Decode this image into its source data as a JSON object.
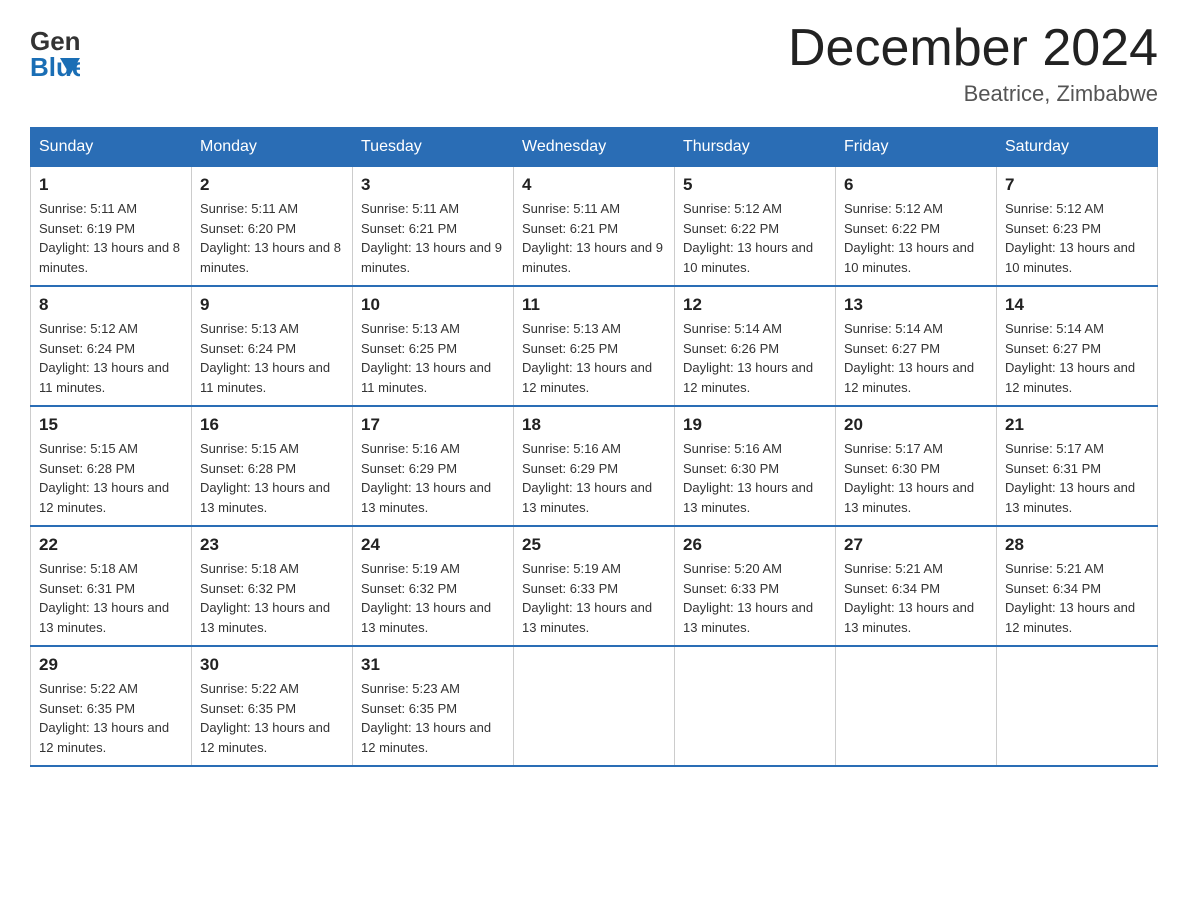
{
  "header": {
    "logo_general": "General",
    "logo_blue": "Blue",
    "month_title": "December 2024",
    "location": "Beatrice, Zimbabwe"
  },
  "weekdays": [
    "Sunday",
    "Monday",
    "Tuesday",
    "Wednesday",
    "Thursday",
    "Friday",
    "Saturday"
  ],
  "weeks": [
    [
      {
        "day": "1",
        "sunrise": "5:11 AM",
        "sunset": "6:19 PM",
        "daylight": "13 hours and 8 minutes."
      },
      {
        "day": "2",
        "sunrise": "5:11 AM",
        "sunset": "6:20 PM",
        "daylight": "13 hours and 8 minutes."
      },
      {
        "day": "3",
        "sunrise": "5:11 AM",
        "sunset": "6:21 PM",
        "daylight": "13 hours and 9 minutes."
      },
      {
        "day": "4",
        "sunrise": "5:11 AM",
        "sunset": "6:21 PM",
        "daylight": "13 hours and 9 minutes."
      },
      {
        "day": "5",
        "sunrise": "5:12 AM",
        "sunset": "6:22 PM",
        "daylight": "13 hours and 10 minutes."
      },
      {
        "day": "6",
        "sunrise": "5:12 AM",
        "sunset": "6:22 PM",
        "daylight": "13 hours and 10 minutes."
      },
      {
        "day": "7",
        "sunrise": "5:12 AM",
        "sunset": "6:23 PM",
        "daylight": "13 hours and 10 minutes."
      }
    ],
    [
      {
        "day": "8",
        "sunrise": "5:12 AM",
        "sunset": "6:24 PM",
        "daylight": "13 hours and 11 minutes."
      },
      {
        "day": "9",
        "sunrise": "5:13 AM",
        "sunset": "6:24 PM",
        "daylight": "13 hours and 11 minutes."
      },
      {
        "day": "10",
        "sunrise": "5:13 AM",
        "sunset": "6:25 PM",
        "daylight": "13 hours and 11 minutes."
      },
      {
        "day": "11",
        "sunrise": "5:13 AM",
        "sunset": "6:25 PM",
        "daylight": "13 hours and 12 minutes."
      },
      {
        "day": "12",
        "sunrise": "5:14 AM",
        "sunset": "6:26 PM",
        "daylight": "13 hours and 12 minutes."
      },
      {
        "day": "13",
        "sunrise": "5:14 AM",
        "sunset": "6:27 PM",
        "daylight": "13 hours and 12 minutes."
      },
      {
        "day": "14",
        "sunrise": "5:14 AM",
        "sunset": "6:27 PM",
        "daylight": "13 hours and 12 minutes."
      }
    ],
    [
      {
        "day": "15",
        "sunrise": "5:15 AM",
        "sunset": "6:28 PM",
        "daylight": "13 hours and 12 minutes."
      },
      {
        "day": "16",
        "sunrise": "5:15 AM",
        "sunset": "6:28 PM",
        "daylight": "13 hours and 13 minutes."
      },
      {
        "day": "17",
        "sunrise": "5:16 AM",
        "sunset": "6:29 PM",
        "daylight": "13 hours and 13 minutes."
      },
      {
        "day": "18",
        "sunrise": "5:16 AM",
        "sunset": "6:29 PM",
        "daylight": "13 hours and 13 minutes."
      },
      {
        "day": "19",
        "sunrise": "5:16 AM",
        "sunset": "6:30 PM",
        "daylight": "13 hours and 13 minutes."
      },
      {
        "day": "20",
        "sunrise": "5:17 AM",
        "sunset": "6:30 PM",
        "daylight": "13 hours and 13 minutes."
      },
      {
        "day": "21",
        "sunrise": "5:17 AM",
        "sunset": "6:31 PM",
        "daylight": "13 hours and 13 minutes."
      }
    ],
    [
      {
        "day": "22",
        "sunrise": "5:18 AM",
        "sunset": "6:31 PM",
        "daylight": "13 hours and 13 minutes."
      },
      {
        "day": "23",
        "sunrise": "5:18 AM",
        "sunset": "6:32 PM",
        "daylight": "13 hours and 13 minutes."
      },
      {
        "day": "24",
        "sunrise": "5:19 AM",
        "sunset": "6:32 PM",
        "daylight": "13 hours and 13 minutes."
      },
      {
        "day": "25",
        "sunrise": "5:19 AM",
        "sunset": "6:33 PM",
        "daylight": "13 hours and 13 minutes."
      },
      {
        "day": "26",
        "sunrise": "5:20 AM",
        "sunset": "6:33 PM",
        "daylight": "13 hours and 13 minutes."
      },
      {
        "day": "27",
        "sunrise": "5:21 AM",
        "sunset": "6:34 PM",
        "daylight": "13 hours and 13 minutes."
      },
      {
        "day": "28",
        "sunrise": "5:21 AM",
        "sunset": "6:34 PM",
        "daylight": "13 hours and 12 minutes."
      }
    ],
    [
      {
        "day": "29",
        "sunrise": "5:22 AM",
        "sunset": "6:35 PM",
        "daylight": "13 hours and 12 minutes."
      },
      {
        "day": "30",
        "sunrise": "5:22 AM",
        "sunset": "6:35 PM",
        "daylight": "13 hours and 12 minutes."
      },
      {
        "day": "31",
        "sunrise": "5:23 AM",
        "sunset": "6:35 PM",
        "daylight": "13 hours and 12 minutes."
      },
      null,
      null,
      null,
      null
    ]
  ]
}
